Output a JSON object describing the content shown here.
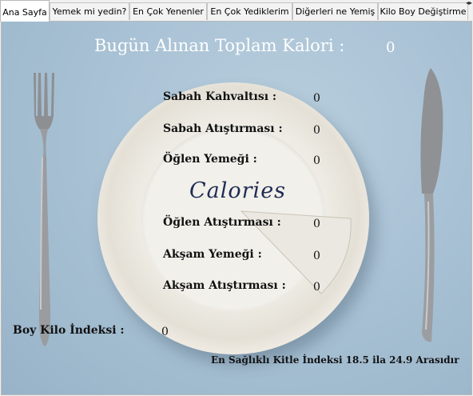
{
  "tabs": [
    {
      "label": "Ana Sayfa",
      "active": true
    },
    {
      "label": "Yemek mi yedin?",
      "active": false
    },
    {
      "label": "En Çok Yenenler",
      "active": false
    },
    {
      "label": "En Çok Yediklerim",
      "active": false
    },
    {
      "label": "Diğerleri ne Yemiş",
      "active": false
    },
    {
      "label": "Kilo Boy Değiştirme",
      "active": false
    }
  ],
  "tab_scroll_icon": "tab-scroll-arrows-icon",
  "header": {
    "total_label": "Bugün Alınan Toplam Kalori :",
    "total_value": "0"
  },
  "plate_text": "Calories",
  "meals": [
    {
      "label": "Sabah Kahvaltısı :",
      "value": "0"
    },
    {
      "label": "Sabah Atıştırması :",
      "value": "0"
    },
    {
      "label": "Öğlen Yemeği :",
      "value": "0"
    },
    {
      "label": "Öğlen Atıştırması :",
      "value": "0"
    },
    {
      "label": "Akşam Yemeği :",
      "value": "0"
    },
    {
      "label": "Akşam Atıştırması :",
      "value": "0"
    }
  ],
  "bmi": {
    "label": "Boy Kilo İndeksi :",
    "value": "0"
  },
  "footer_note": "En Sağlıklı Kitle İndeksi 18.5 ila 24.9 Arasıdır",
  "colors": {
    "background": "#a9c2d5",
    "title_text": "#ffffff",
    "calories_word": "#1f2c55"
  }
}
